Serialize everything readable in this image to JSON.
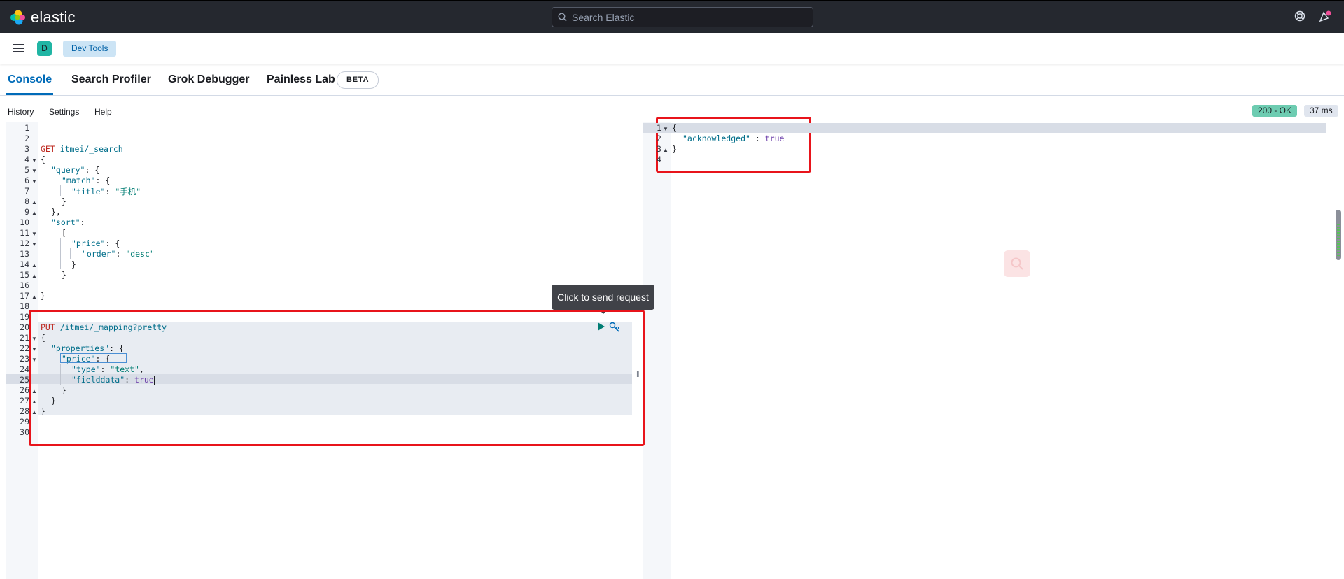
{
  "header": {
    "logo_text": "elastic",
    "search_placeholder": "Search Elastic"
  },
  "breadcrumb": {
    "avatar_letter": "D",
    "current": "Dev Tools"
  },
  "tabs": [
    {
      "label": "Console",
      "active": true
    },
    {
      "label": "Search Profiler",
      "active": false
    },
    {
      "label": "Grok Debugger",
      "active": false
    },
    {
      "label": "Painless Lab",
      "active": false
    }
  ],
  "beta_badge": "BETA",
  "console_menu": [
    "History",
    "Settings",
    "Help"
  ],
  "status": {
    "code": "200 - OK",
    "time": "37 ms"
  },
  "tooltip": "Click to send request",
  "colors": {
    "accent": "#006bb8",
    "status_ok": "#6dccb1",
    "highlight_border": "#e8141b"
  },
  "editor": {
    "line_numbers": [
      "1",
      "2",
      "3",
      "4",
      "5",
      "6",
      "7",
      "8",
      "9",
      "10",
      "11",
      "12",
      "13",
      "14",
      "15",
      "16",
      "17",
      "18",
      "19",
      "20",
      "21",
      "22",
      "23",
      "24",
      "25",
      "26",
      "27",
      "28",
      "29",
      "30"
    ],
    "lines": {
      "l3_method": "GET",
      "l3_path": " itmei/_search",
      "l4": "{",
      "l5_key": "\"query\"",
      "l5_rest": ": {",
      "l6_key": "\"match\"",
      "l6_rest": ": {",
      "l7_key": "\"title\"",
      "l7_colon": ": ",
      "l7_val": "\"手机\"",
      "l8": "}",
      "l9": "},",
      "l10_key": "\"sort\"",
      "l10_rest": ":",
      "l11": "[",
      "l12": "{",
      "l12_key": "\"price\"",
      "l12_rest": ": {",
      "l13_key": "\"order\"",
      "l13_colon": ": ",
      "l13_val": "\"desc\"",
      "l14": "}",
      "l15": "}",
      "l17": "}",
      "l20_method": "PUT",
      "l20_path": " /itmei/_mapping?pretty",
      "l21": "{",
      "l22_key": "\"properties\"",
      "l22_rest": ": {",
      "l23_key": "\"price\"",
      "l23_rest": ": {",
      "l24_key": "\"type\"",
      "l24_colon": ": ",
      "l24_val": "\"text\"",
      "l24_comma": ",",
      "l25_key": "\"fielddata\"",
      "l25_colon": ": ",
      "l25_val": "true",
      "l26": "}",
      "l27": "}",
      "l28": "}"
    }
  },
  "output": {
    "line_numbers": [
      "1",
      "2",
      "3",
      "4"
    ],
    "l1": "{",
    "l2_key": "\"acknowledged\"",
    "l2_colon": " : ",
    "l2_val": "true",
    "l3": "}"
  }
}
